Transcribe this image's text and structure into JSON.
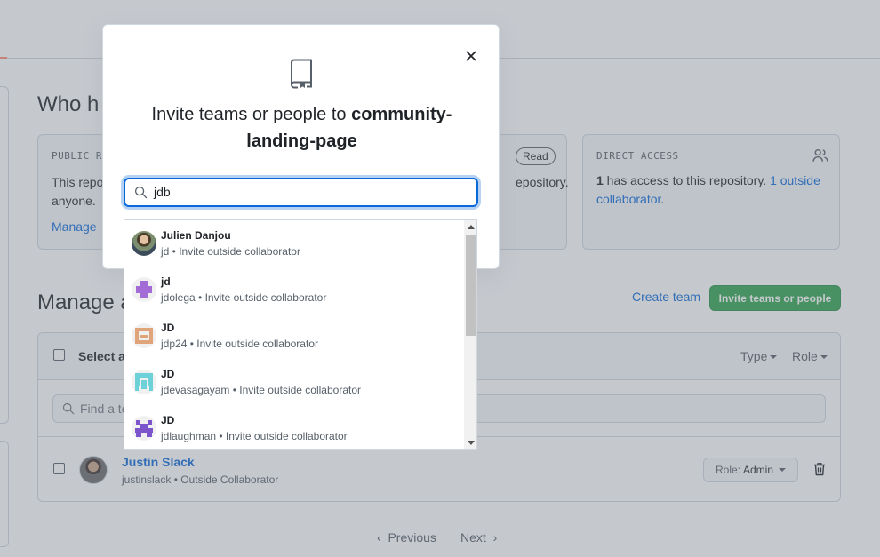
{
  "page": {
    "who_title": "Who h",
    "public_box": {
      "label": "PUBLIC RE",
      "badge": "Read",
      "text": "This repo",
      "text2": "anyone.",
      "text_right": "epository.",
      "link": "Manage"
    },
    "direct_box": {
      "label": "DIRECT ACCESS",
      "count": "1",
      "text": " has access to this repository. ",
      "link": "1 outside collaborator",
      "period": "."
    },
    "manage_title": "Manage a",
    "create_team": "Create team",
    "invite_button": "Invite teams or people",
    "table": {
      "select_all": "Select al",
      "type": "Type",
      "role": "Role",
      "find_placeholder": "Find a te"
    },
    "member": {
      "name": "Justin Slack",
      "sub": "justinslack • Outside Collaborator",
      "role_prefix": "Role:",
      "role_value": "Admin"
    },
    "pager": {
      "previous": "Previous",
      "next": "Next"
    }
  },
  "modal": {
    "title_prefix": "Invite teams or people to ",
    "repo_line1": "community-",
    "repo_line2": "landing-page",
    "search_value": "jdb"
  },
  "suggestions": [
    {
      "name": "Julien Danjou",
      "sub": "jd • Invite outside collaborator",
      "avatar": "photo"
    },
    {
      "name": "jd",
      "sub": "jdolega • Invite outside collaborator",
      "avatar": "#a36bd6"
    },
    {
      "name": "JD",
      "sub": "jdp24 • Invite outside collaborator",
      "avatar": "#e0a47a"
    },
    {
      "name": "JD",
      "sub": "jdevasagayam • Invite outside collaborator",
      "avatar": "#6cd2d8"
    },
    {
      "name": "JD",
      "sub": "jdlaughman • Invite outside collaborator",
      "avatar": "#7c55cc"
    }
  ],
  "colors": {
    "primary_blue": "#0969da",
    "invite_green": "#2da44e",
    "border": "#d0d7de",
    "muted": "#57606a"
  }
}
